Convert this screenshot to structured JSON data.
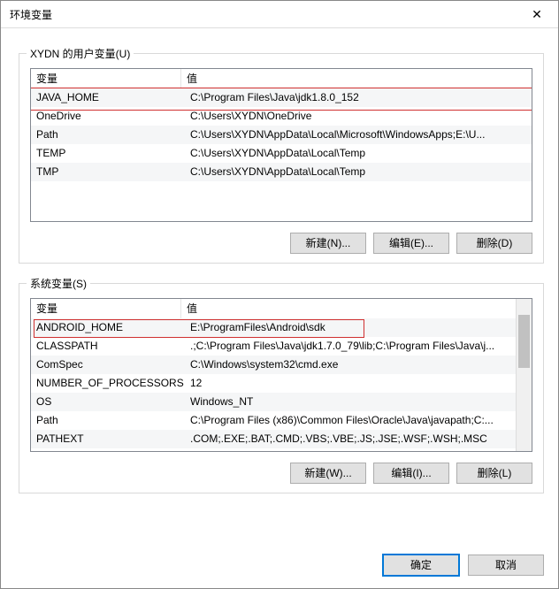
{
  "window": {
    "title": "环境变量"
  },
  "user_section": {
    "legend": "XYDN 的用户变量(U)",
    "col_var": "变量",
    "col_val": "值",
    "rows": [
      {
        "name": "JAVA_HOME",
        "value": "C:\\Program Files\\Java\\jdk1.8.0_152"
      },
      {
        "name": "OneDrive",
        "value": "C:\\Users\\XYDN\\OneDrive"
      },
      {
        "name": "Path",
        "value": "C:\\Users\\XYDN\\AppData\\Local\\Microsoft\\WindowsApps;E:\\U..."
      },
      {
        "name": "TEMP",
        "value": "C:\\Users\\XYDN\\AppData\\Local\\Temp"
      },
      {
        "name": "TMP",
        "value": "C:\\Users\\XYDN\\AppData\\Local\\Temp"
      }
    ],
    "btn_new": "新建(N)...",
    "btn_edit": "编辑(E)...",
    "btn_delete": "删除(D)"
  },
  "system_section": {
    "legend": "系统变量(S)",
    "col_var": "变量",
    "col_val": "值",
    "rows": [
      {
        "name": "ANDROID_HOME",
        "value": "E:\\ProgramFiles\\Android\\sdk"
      },
      {
        "name": "CLASSPATH",
        "value": ".;C:\\Program Files\\Java\\jdk1.7.0_79\\lib;C:\\Program Files\\Java\\j..."
      },
      {
        "name": "ComSpec",
        "value": "C:\\Windows\\system32\\cmd.exe"
      },
      {
        "name": "NUMBER_OF_PROCESSORS",
        "value": "12"
      },
      {
        "name": "OS",
        "value": "Windows_NT"
      },
      {
        "name": "Path",
        "value": "C:\\Program Files (x86)\\Common Files\\Oracle\\Java\\javapath;C:..."
      },
      {
        "name": "PATHEXT",
        "value": ".COM;.EXE;.BAT;.CMD;.VBS;.VBE;.JS;.JSE;.WSF;.WSH;.MSC"
      }
    ],
    "btn_new": "新建(W)...",
    "btn_edit": "编辑(I)...",
    "btn_delete": "删除(L)"
  },
  "footer": {
    "ok": "确定",
    "cancel": "取消"
  }
}
